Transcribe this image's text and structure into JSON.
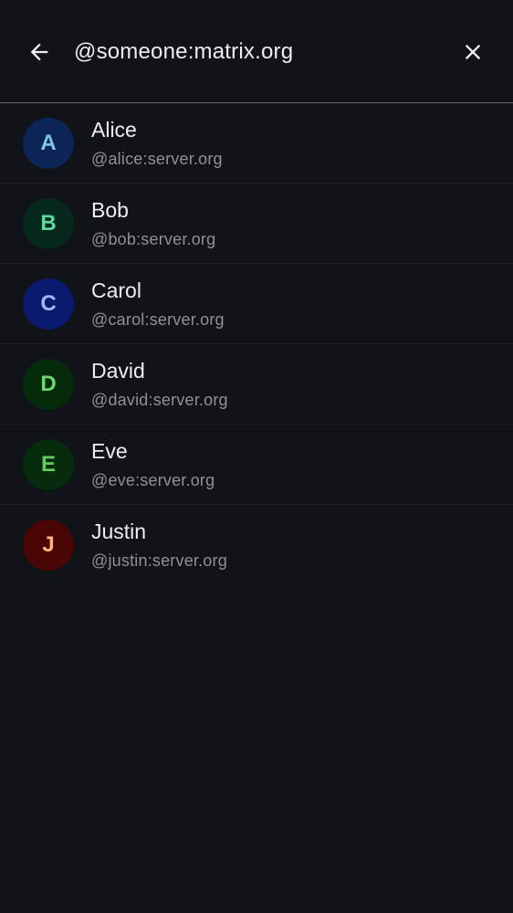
{
  "search": {
    "value": "@someone:matrix.org",
    "back_icon": "arrow-left-icon",
    "clear_icon": "close-icon"
  },
  "users": [
    {
      "initial": "A",
      "name": "Alice",
      "id": "@alice:server.org",
      "bg": "#0b2556",
      "fg": "#7ec8e3"
    },
    {
      "initial": "B",
      "name": "Bob",
      "id": "@bob:server.org",
      "bg": "#05291c",
      "fg": "#5fd6a4"
    },
    {
      "initial": "C",
      "name": "Carol",
      "id": "@carol:server.org",
      "bg": "#0a1a6e",
      "fg": "#9fb8ff"
    },
    {
      "initial": "D",
      "name": "David",
      "id": "@david:server.org",
      "bg": "#052b0b",
      "fg": "#6dd66d"
    },
    {
      "initial": "E",
      "name": "Eve",
      "id": "@eve:server.org",
      "bg": "#062b0d",
      "fg": "#5fcf5a"
    },
    {
      "initial": "J",
      "name": "Justin",
      "id": "@justin:server.org",
      "bg": "#4a0505",
      "fg": "#ffb480"
    }
  ],
  "colors": {
    "background": "#101318",
    "divider": "#5f6368",
    "text_primary": "#eceff1",
    "text_secondary": "#8e9297"
  }
}
